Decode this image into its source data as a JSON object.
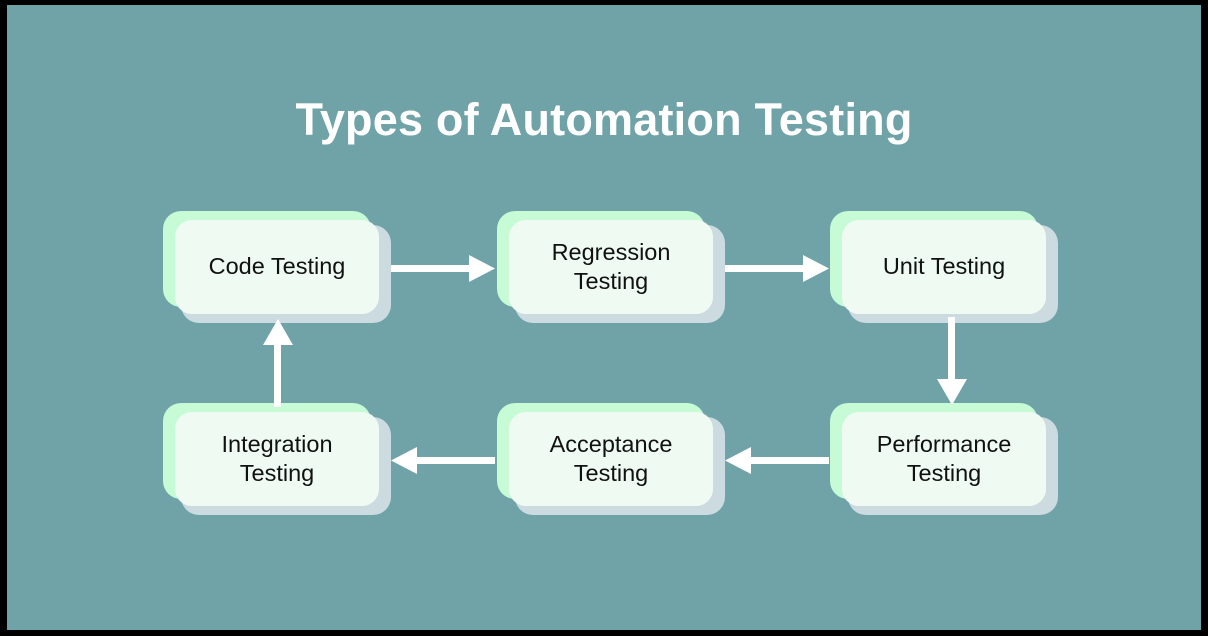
{
  "diagram": {
    "title": "Types of Automation Testing",
    "type": "flowchart-cycle",
    "background_color": "#6fa3a8",
    "title_color": "#ffffff",
    "node_face_color": "#effbf2",
    "node_accent_color": "#c6fbd6",
    "node_shadow_color": "#ccdbe0",
    "arrow_color": "#ffffff",
    "nodes": [
      {
        "id": "code-testing",
        "label": "Code Testing",
        "row": 1,
        "col": 1
      },
      {
        "id": "regression-testing",
        "label": "Regression\nTesting",
        "row": 1,
        "col": 2
      },
      {
        "id": "unit-testing",
        "label": "Unit Testing",
        "row": 1,
        "col": 3
      },
      {
        "id": "performance-testing",
        "label": "Performance\nTesting",
        "row": 2,
        "col": 3
      },
      {
        "id": "acceptance-testing",
        "label": "Acceptance\nTesting",
        "row": 2,
        "col": 2
      },
      {
        "id": "integration-testing",
        "label": "Integration\nTesting",
        "row": 2,
        "col": 1
      }
    ],
    "edges": [
      {
        "id": "edge-code-to-regression",
        "from": "code-testing",
        "to": "regression-testing",
        "direction": "right"
      },
      {
        "id": "edge-regression-to-unit",
        "from": "regression-testing",
        "to": "unit-testing",
        "direction": "right"
      },
      {
        "id": "edge-unit-to-performance",
        "from": "unit-testing",
        "to": "performance-testing",
        "direction": "down"
      },
      {
        "id": "edge-performance-to-acceptance",
        "from": "performance-testing",
        "to": "acceptance-testing",
        "direction": "left"
      },
      {
        "id": "edge-acceptance-to-integration",
        "from": "acceptance-testing",
        "to": "integration-testing",
        "direction": "left"
      },
      {
        "id": "edge-integration-to-code",
        "from": "integration-testing",
        "to": "code-testing",
        "direction": "up"
      }
    ]
  }
}
